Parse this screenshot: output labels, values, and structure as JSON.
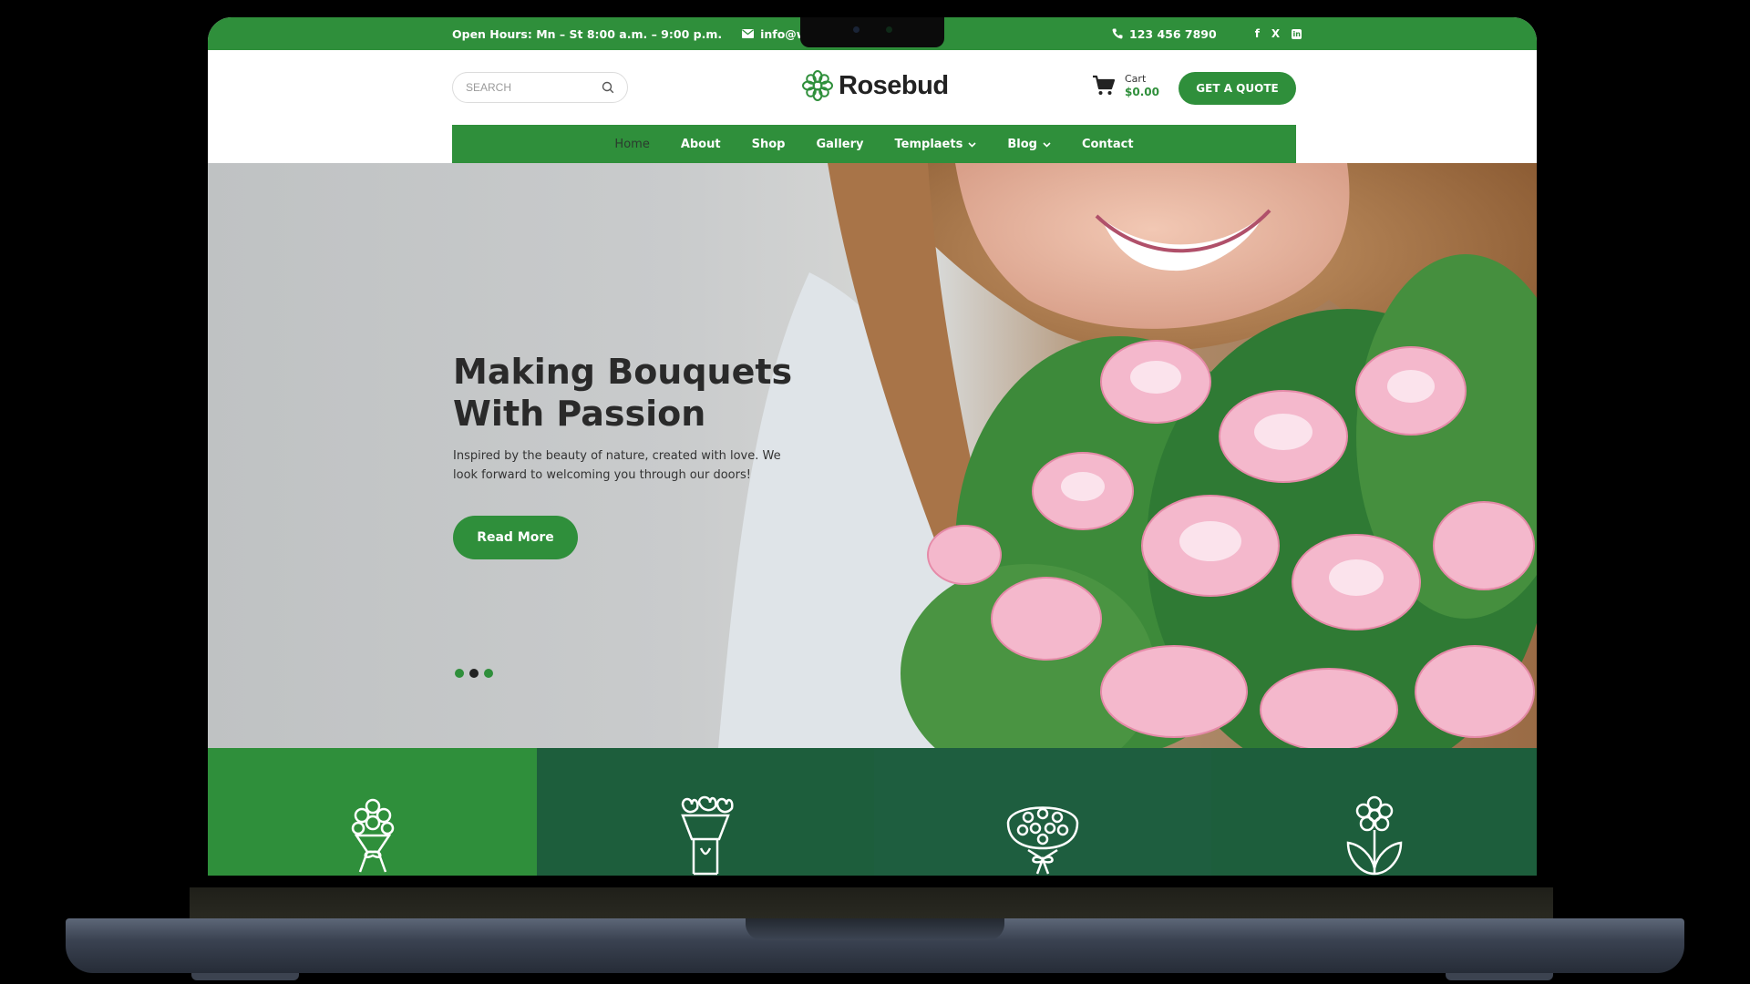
{
  "topbar": {
    "hours": "Open Hours: Mn – St 8:00 a.m. – 9:00 p.m.",
    "email": "info@website.co",
    "phone": "123 456 7890",
    "social": [
      {
        "icon": "facebook-icon",
        "glyph": "f"
      },
      {
        "icon": "x-icon",
        "glyph": "X"
      },
      {
        "icon": "linkedin-icon",
        "glyph": "in"
      }
    ]
  },
  "header": {
    "search_placeholder": "SEARCH",
    "logo": "Rosebud",
    "cart_label": "Cart",
    "cart_total": "$0.00",
    "quote_button": "GET A QUOTE"
  },
  "nav": {
    "items": [
      {
        "label": "Home",
        "active": true
      },
      {
        "label": "About"
      },
      {
        "label": "Shop"
      },
      {
        "label": "Gallery"
      },
      {
        "label": "Templaets",
        "dropdown": true
      },
      {
        "label": "Blog",
        "dropdown": true
      },
      {
        "label": "Contact"
      }
    ]
  },
  "hero": {
    "title_line1": "Making Bouquets",
    "title_line2": "With Passion",
    "text": "Inspired by the beauty of nature, created with love. We look forward to welcoming you through our doors!",
    "button": "Read More",
    "slides": 3,
    "current_slide": 2
  },
  "features": [
    {
      "icon": "bouquet-icon"
    },
    {
      "icon": "tulip-bouquet-icon"
    },
    {
      "icon": "flower-bundle-icon"
    },
    {
      "icon": "flower-icon"
    }
  ],
  "colors": {
    "brand_green": "#2f8f3b",
    "dark_green": "#1d5e3c"
  }
}
